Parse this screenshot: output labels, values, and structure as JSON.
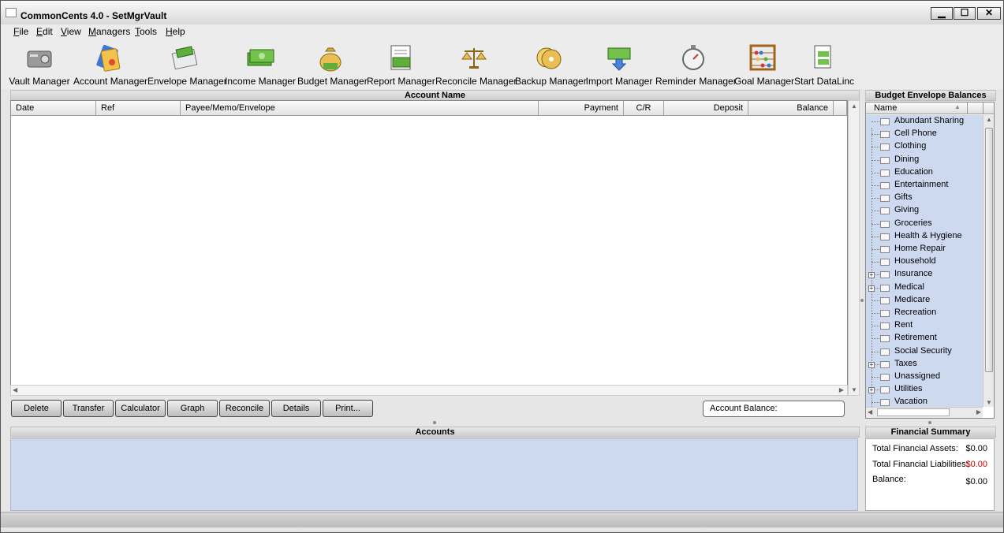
{
  "window": {
    "title": "CommonCents 4.0 - SetMgrVault",
    "minimize": "▁",
    "maximize": "☐",
    "close": "✕"
  },
  "menu": {
    "file": "File",
    "edit": "Edit",
    "view": "View",
    "managers": "Managers",
    "tools": "Tools",
    "help": "Help"
  },
  "toolbar": {
    "vault": "Vault Manager",
    "account": "Account Manager",
    "envelope": "Envelope Manager",
    "income": "Income Manager",
    "budget": "Budget Manager",
    "report": "Report Manager",
    "reconcile": "Reconcile Manager",
    "backup": "Backup Manager",
    "import": "Import Manager",
    "reminder": "Reminder Manager",
    "goal": "Goal Manager",
    "datalinc": "Start DataLinc"
  },
  "register": {
    "title": "Account Name",
    "columns": {
      "date": "Date",
      "ref": "Ref",
      "payee": "Payee/Memo/Envelope",
      "payment": "Payment",
      "cr": "C/R",
      "deposit": "Deposit",
      "balance": "Balance"
    },
    "buttons": {
      "delete": "Delete",
      "transfer": "Transfer",
      "calculator": "Calculator",
      "graph": "Graph",
      "reconcile": "Reconcile",
      "details": "Details",
      "print": "Print..."
    },
    "account_balance_label": "Account Balance:"
  },
  "envelopes": {
    "title": "Budget Envelope Balances",
    "column_name": "Name",
    "items": [
      {
        "label": "Abundant Sharing",
        "expandable": false
      },
      {
        "label": "Cell Phone",
        "expandable": false
      },
      {
        "label": "Clothing",
        "expandable": false
      },
      {
        "label": "Dining",
        "expandable": false
      },
      {
        "label": "Education",
        "expandable": false
      },
      {
        "label": "Entertainment",
        "expandable": false
      },
      {
        "label": "Gifts",
        "expandable": false
      },
      {
        "label": "Giving",
        "expandable": false
      },
      {
        "label": "Groceries",
        "expandable": false
      },
      {
        "label": "Health & Hygiene",
        "expandable": false
      },
      {
        "label": "Home Repair",
        "expandable": false
      },
      {
        "label": "Household",
        "expandable": false
      },
      {
        "label": "Insurance",
        "expandable": true
      },
      {
        "label": "Medical",
        "expandable": true
      },
      {
        "label": "Medicare",
        "expandable": false
      },
      {
        "label": "Recreation",
        "expandable": false
      },
      {
        "label": "Rent",
        "expandable": false
      },
      {
        "label": "Retirement",
        "expandable": false
      },
      {
        "label": "Social Security",
        "expandable": false
      },
      {
        "label": "Taxes",
        "expandable": true
      },
      {
        "label": "Unassigned",
        "expandable": false
      },
      {
        "label": "Utilities",
        "expandable": true
      },
      {
        "label": "Vacation",
        "expandable": false
      }
    ]
  },
  "accounts": {
    "title": "Accounts"
  },
  "financial_summary": {
    "title": "Financial Summary",
    "assets_label": "Total Financial Assets:",
    "assets_value": "$0.00",
    "liabilities_label": "Total Financial Liabilities:",
    "liabilities_value": "$0.00",
    "balance_label": "Balance:",
    "balance_value": "$0.00",
    "liabilities_color": "#cc0000"
  }
}
